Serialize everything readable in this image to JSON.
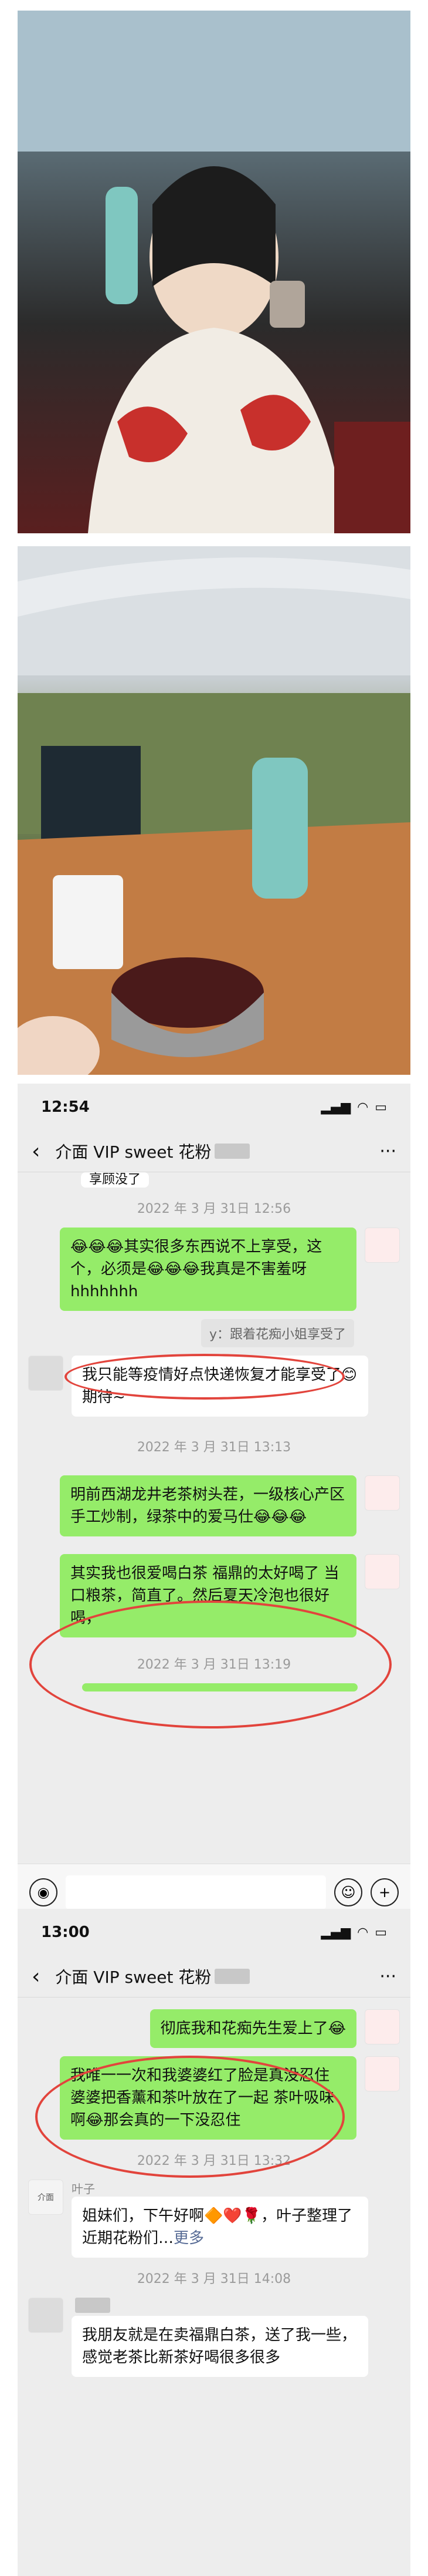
{
  "chat1": {
    "time": "12:54",
    "title": "介面 VIP sweet 花粉",
    "top_partial": "享顾没了",
    "ts1": "2022 年 3 月 31日 12:56",
    "m1": "😂😂😂其实很多东西说不上享受，这个，必须是😂😂😂我真是不害羞呀hhhhhhh",
    "quote1": "y：跟着花痴小姐享受了",
    "m2": "我只能等疫情好点快递恢复才能享受了😊期待~",
    "ts2": "2022 年 3 月 31日 13:13",
    "m3": "明前西湖龙井老茶树头茬，一级核心产区手工炒制，绿茶中的爱马仕😂😂😂",
    "m4": "其实我也很爱喝白茶 福鼎的太好喝了 当口粮茶，简直了。然后夏天冷泡也很好喝，",
    "ts3": "2022 年 3 月 31日 13:19"
  },
  "chat2": {
    "time": "13:00",
    "title": "介面 VIP sweet 花粉",
    "m1": "彻底我和花痴先生爱上了😂",
    "m2": "我唯一一次和我婆婆红了脸是真没忍住 婆婆把香薰和茶叶放在了一起 茶叶吸味啊😂那会真的一下没忍住",
    "ts1": "2022 年 3 月 31日 13:32",
    "sender1": "叶子",
    "avatar1": "介面",
    "m3": "姐妹们，下午好啊🔶❤️🌹，叶子整理了近期花粉们…",
    "m3_more": "更多",
    "ts2": "2022 年 3 月 31日 14:08",
    "m4": "我朋友就是在卖福鼎白茶，送了我一些，感觉老茶比新茶好喝很多很多"
  },
  "colors": {
    "accent_red": "#e2443c",
    "bubble_green": "#95ec69",
    "chat_bg": "#ededed"
  }
}
